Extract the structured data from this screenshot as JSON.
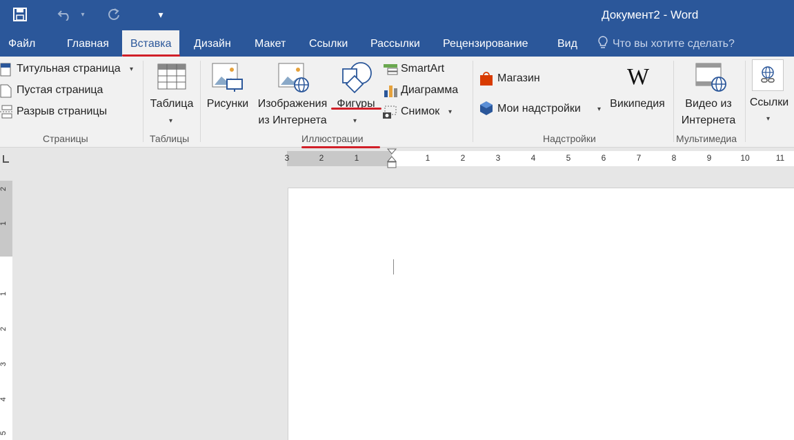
{
  "window": {
    "title": "Документ2 - Word"
  },
  "qat": {
    "save": "save-icon",
    "undo": "undo-icon",
    "redo": "redo-icon",
    "customize": "▾"
  },
  "tabs": [
    {
      "label": "Файл"
    },
    {
      "label": "Главная"
    },
    {
      "label": "Вставка"
    },
    {
      "label": "Дизайн"
    },
    {
      "label": "Макет"
    },
    {
      "label": "Ссылки"
    },
    {
      "label": "Рассылки"
    },
    {
      "label": "Рецензирование"
    },
    {
      "label": "Вид"
    }
  ],
  "tell_me": {
    "placeholder": "Что вы хотите сделать?"
  },
  "ribbon": {
    "pages": {
      "cover": "Титульная страница",
      "blank": "Пустая страница",
      "break": "Разрыв страницы",
      "label": "Страницы"
    },
    "tables": {
      "table": "Таблица",
      "label": "Таблицы"
    },
    "illustrations": {
      "pictures": "Рисунки",
      "online_line1": "Изображения",
      "online_line2": "из Интернета",
      "shapes": "Фигуры",
      "smartart": "SmartArt",
      "chart": "Диаграмма",
      "screenshot": "Снимок",
      "label": "Иллюстрации"
    },
    "addins": {
      "store": "Магазин",
      "my_addins": "Мои надстройки",
      "wikipedia": "Википедия",
      "label": "Надстройки"
    },
    "media": {
      "line1": "Видео из",
      "line2": "Интернета",
      "label": "Мультимедиа"
    },
    "links": {
      "label": "Ссылки"
    }
  },
  "ruler": {
    "h_left": [
      "3",
      "2",
      "1"
    ],
    "h_right": [
      "1",
      "2",
      "3",
      "4",
      "5",
      "6",
      "7",
      "8",
      "9",
      "10",
      "11"
    ],
    "v": [
      "2",
      "1",
      "1",
      "2",
      "3",
      "4",
      "5"
    ]
  },
  "colors": {
    "accent": "#2b579a",
    "annotation": "#d11f28",
    "ribbon_bg": "#f1f1f1"
  }
}
